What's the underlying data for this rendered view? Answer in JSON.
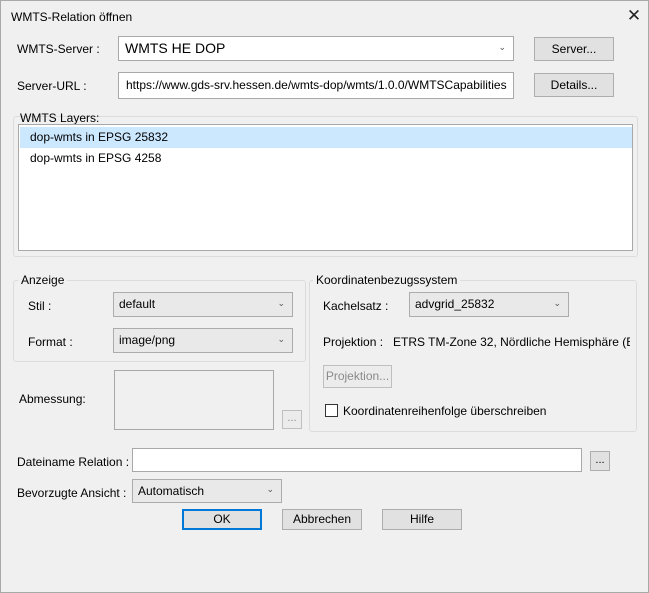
{
  "window": {
    "title": "WMTS-Relation öffnen",
    "close_glyph": "✕"
  },
  "server": {
    "label": "WMTS-Server :",
    "value": "WMTS HE DOP",
    "button": "Server..."
  },
  "server_url": {
    "label": "Server-URL :",
    "value": "https://www.gds-srv.hessen.de/wmts-dop/wmts/1.0.0/WMTSCapabilities",
    "button": "Details..."
  },
  "layers": {
    "title": "WMTS Layers:",
    "items": [
      {
        "label": "dop-wmts in EPSG 25832",
        "selected": true
      },
      {
        "label": "dop-wmts in EPSG 4258",
        "selected": false
      }
    ]
  },
  "anzeige": {
    "title": "Anzeige",
    "stil_label": "Stil :",
    "stil_value": "default",
    "format_label": "Format :",
    "format_value": "image/png"
  },
  "abmessung": {
    "label": "Abmessung:",
    "browse": "..."
  },
  "crs": {
    "title": "Koordinatenbezugssystem",
    "kachelsatz_label": "Kachelsatz :",
    "kachelsatz_value": "advgrid_25832",
    "projektion_label": "Projektion :",
    "projektion_value": "ETRS TM-Zone 32, Nördliche Hemisphäre (E",
    "projektion_button": "Projektion...",
    "override_label": "Koordinatenreihenfolge überschreiben",
    "override_checked": false
  },
  "dateiname": {
    "label": "Dateiname Relation :",
    "value": "",
    "browse": "..."
  },
  "ansicht": {
    "label": "Bevorzugte Ansicht :",
    "value": "Automatisch"
  },
  "buttons": {
    "ok": "OK",
    "cancel": "Abbrechen",
    "help": "Hilfe"
  },
  "arrow_glyph": "⌄"
}
